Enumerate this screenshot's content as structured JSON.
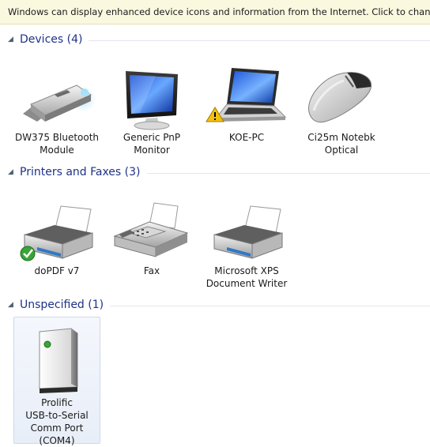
{
  "infobar": {
    "text": "Windows can display enhanced device icons and information from the Internet. Click to change..."
  },
  "groups": {
    "devices": {
      "header": "Devices (4)",
      "items": [
        {
          "label": "DW375 Bluetooth\nModule",
          "icon": "bluetooth-usb-dongle-icon"
        },
        {
          "label": "Generic PnP\nMonitor",
          "icon": "monitor-icon"
        },
        {
          "label": "KOE-PC",
          "icon": "laptop-icon",
          "badge": "warning-icon"
        },
        {
          "label": "Ci25m Notebk\nOptical",
          "icon": "mouse-icon"
        }
      ]
    },
    "printers": {
      "header": "Printers and Faxes (3)",
      "items": [
        {
          "label": "doPDF v7",
          "icon": "printer-icon",
          "badge": "default-check-icon"
        },
        {
          "label": "Fax",
          "icon": "fax-icon"
        },
        {
          "label": "Microsoft XPS\nDocument Writer",
          "icon": "printer-icon"
        }
      ]
    },
    "unspecified": {
      "header": "Unspecified (1)",
      "items": [
        {
          "label": "Prolific\nUSB-to-Serial\nComm Port\n(COM4)",
          "icon": "serial-port-device-icon"
        }
      ]
    }
  },
  "colors": {
    "infobar_bg": "#fbf8e0",
    "group_title": "#1e3287",
    "selection_bg": "#e8eef8"
  }
}
